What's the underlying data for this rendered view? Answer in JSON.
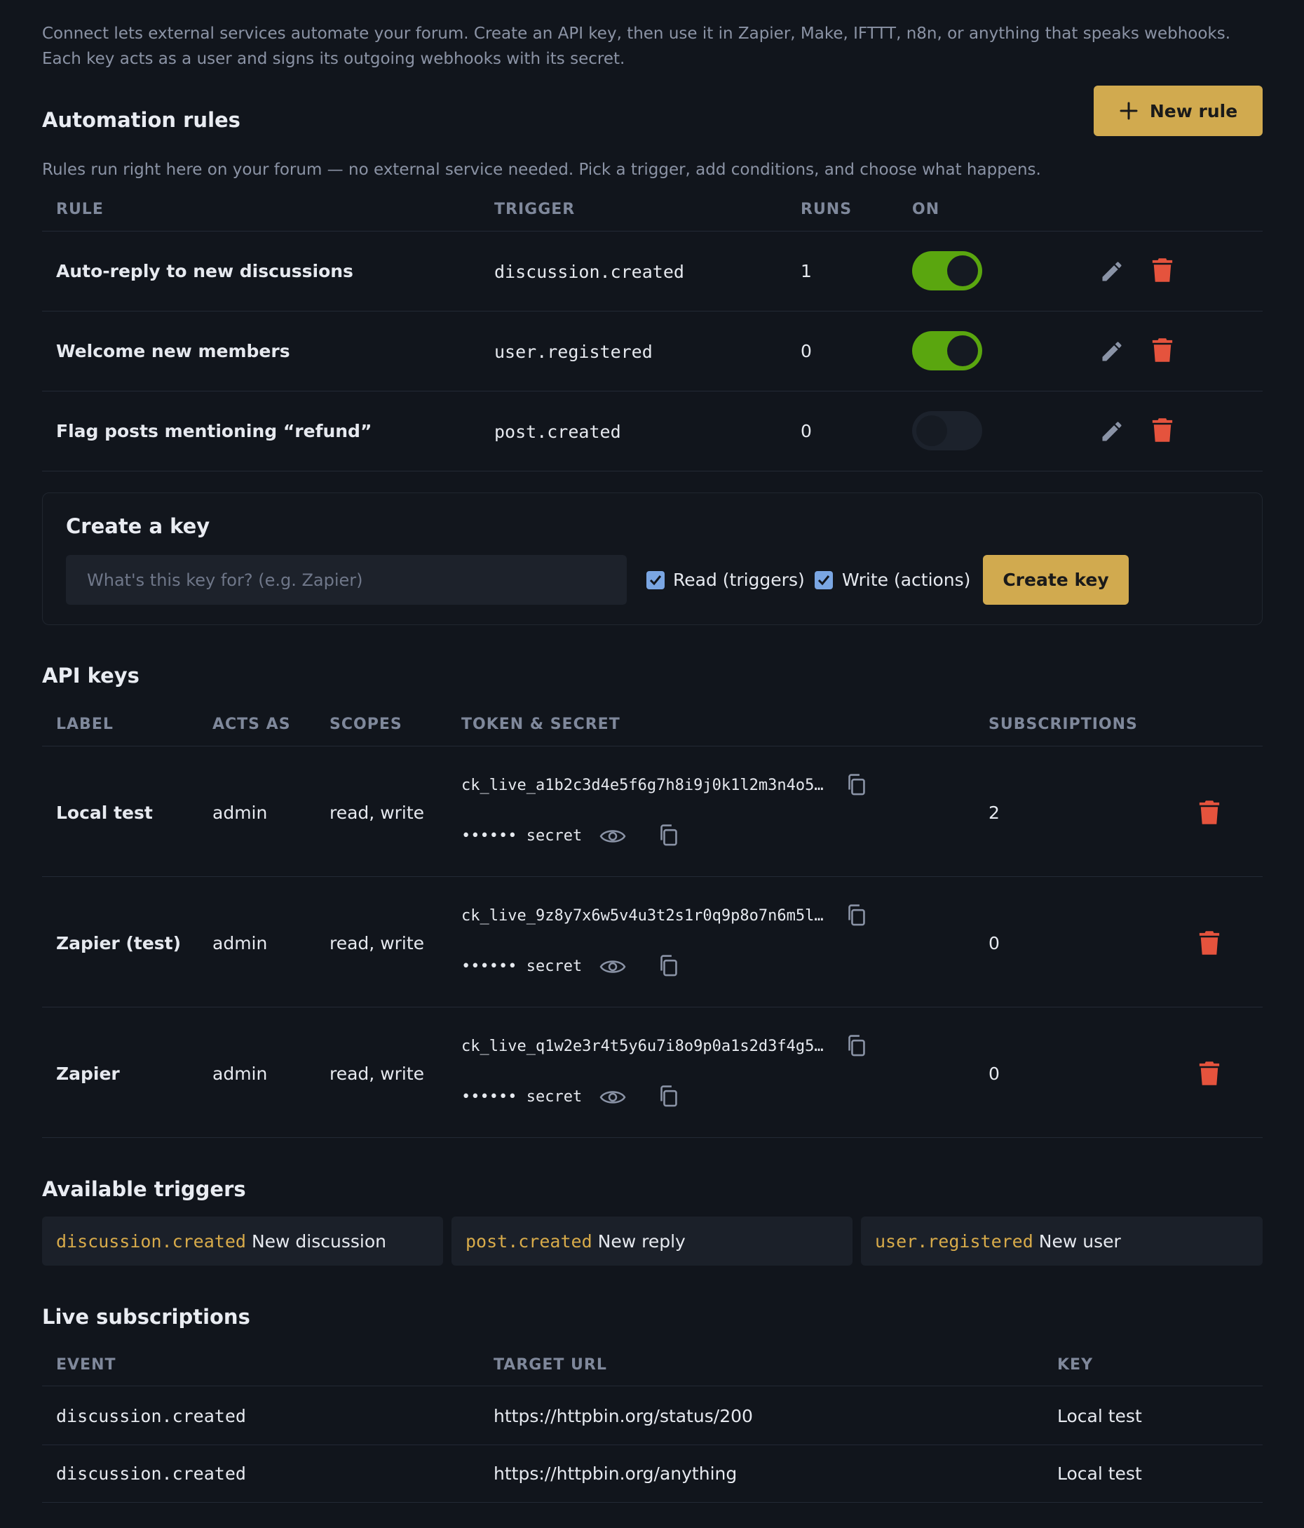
{
  "intro": "Connect lets external services automate your forum. Create an API key, then use it in Zapier, Make, IFTTT, n8n, or anything that speaks webhooks. Each key acts as a user and signs its outgoing webhooks with its secret.",
  "rules": {
    "title": "Automation rules",
    "new_rule_label": "New rule",
    "subtitle": "Rules run right here on your forum — no external service needed. Pick a trigger, add conditions, and choose what happens.",
    "columns": [
      "RULE",
      "TRIGGER",
      "RUNS",
      "ON"
    ],
    "items": [
      {
        "name": "Auto-reply to new discussions",
        "trigger": "discussion.created",
        "runs": "1",
        "on": true
      },
      {
        "name": "Welcome new members",
        "trigger": "user.registered",
        "runs": "0",
        "on": true
      },
      {
        "name": "Flag posts mentioning “refund”",
        "trigger": "post.created",
        "runs": "0",
        "on": false
      }
    ]
  },
  "create_key": {
    "title": "Create a key",
    "placeholder": "What's this key for? (e.g. Zapier)",
    "read_label": "Read (triggers)",
    "write_label": "Write (actions)",
    "button": "Create key"
  },
  "api_keys": {
    "title": "API keys",
    "columns": [
      "LABEL",
      "ACTS AS",
      "SCOPES",
      "TOKEN & SECRET",
      "SUBSCRIPTIONS"
    ],
    "items": [
      {
        "label": "Local test",
        "acts_as": "admin",
        "scopes": "read, write",
        "token": "ck_live_a1b2c3d4e5f6g7h8i9j0k1l2m3n4o5…",
        "secret_mask": "•••••• secret",
        "subscriptions": "2"
      },
      {
        "label": "Zapier (test)",
        "acts_as": "admin",
        "scopes": "read, write",
        "token": "ck_live_9z8y7x6w5v4u3t2s1r0q9p8o7n6m5l…",
        "secret_mask": "•••••• secret",
        "subscriptions": "0"
      },
      {
        "label": "Zapier",
        "acts_as": "admin",
        "scopes": "read, write",
        "token": "ck_live_q1w2e3r4t5y6u7i8o9p0a1s2d3f4g5…",
        "secret_mask": "•••••• secret",
        "subscriptions": "0"
      }
    ]
  },
  "triggers": {
    "title": "Available triggers",
    "items": [
      {
        "code": "discussion.created",
        "label": "New discussion"
      },
      {
        "code": "post.created",
        "label": "New reply"
      },
      {
        "code": "user.registered",
        "label": "New user"
      }
    ]
  },
  "subscriptions": {
    "title": "Live subscriptions",
    "columns": [
      "EVENT",
      "TARGET URL",
      "KEY"
    ],
    "items": [
      {
        "event": "discussion.created",
        "url": "https://httpbin.org/status/200",
        "key": "Local test"
      },
      {
        "event": "discussion.created",
        "url": "https://httpbin.org/anything",
        "key": "Local test"
      }
    ]
  },
  "colors": {
    "accent": "#d1aa4f",
    "toggle_on": "#5aa60f",
    "danger": "#e5533d",
    "muted": "#8b93a5"
  }
}
